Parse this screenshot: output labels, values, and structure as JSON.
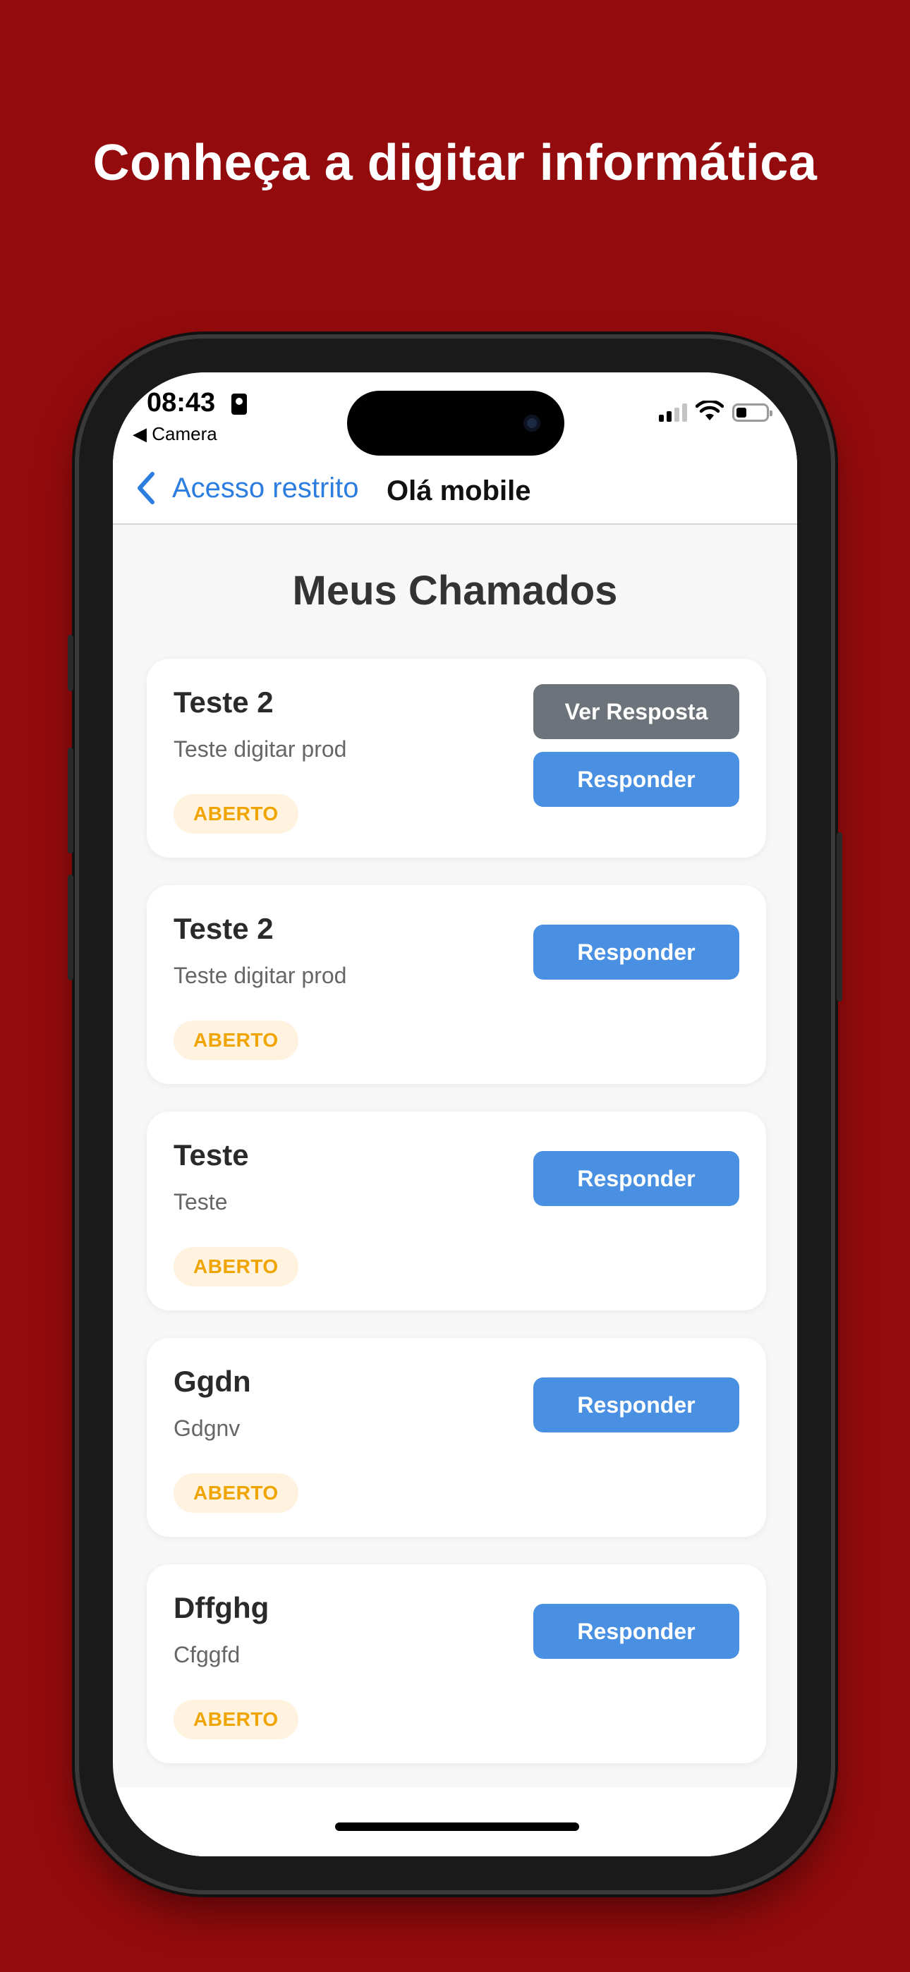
{
  "headline": "Conheça a digitar informática",
  "status_bar": {
    "time": "08:43",
    "back_app": "◀ Camera"
  },
  "navbar": {
    "back_label": "Acesso restrito",
    "title": "Olá mobile"
  },
  "page_title": "Meus Chamados",
  "tickets": [
    {
      "title": "Teste 2",
      "description": "Teste digitar prod",
      "status": "ABERTO",
      "view_label": "Ver Resposta",
      "reply_label": "Responder"
    },
    {
      "title": "Teste 2",
      "description": "Teste digitar prod",
      "status": "ABERTO",
      "reply_label": "Responder"
    },
    {
      "title": "Teste",
      "description": "Teste",
      "status": "ABERTO",
      "reply_label": "Responder"
    },
    {
      "title": "Ggdn",
      "description": "Gdgnv",
      "status": "ABERTO",
      "reply_label": "Responder"
    },
    {
      "title": "Dffghg",
      "description": "Cfggfd",
      "status": "ABERTO",
      "reply_label": "Responder"
    }
  ],
  "colors": {
    "background": "#940b0d",
    "primary_button": "#4a90e2",
    "secondary_button": "#6c737a",
    "status_badge_text": "#f0a400",
    "status_badge_bg": "#fff3e0",
    "link": "#2b7de0"
  },
  "icons": {
    "back": "chevron-left-icon",
    "signal": "cellular-signal-icon",
    "wifi": "wifi-icon",
    "battery": "battery-icon"
  }
}
